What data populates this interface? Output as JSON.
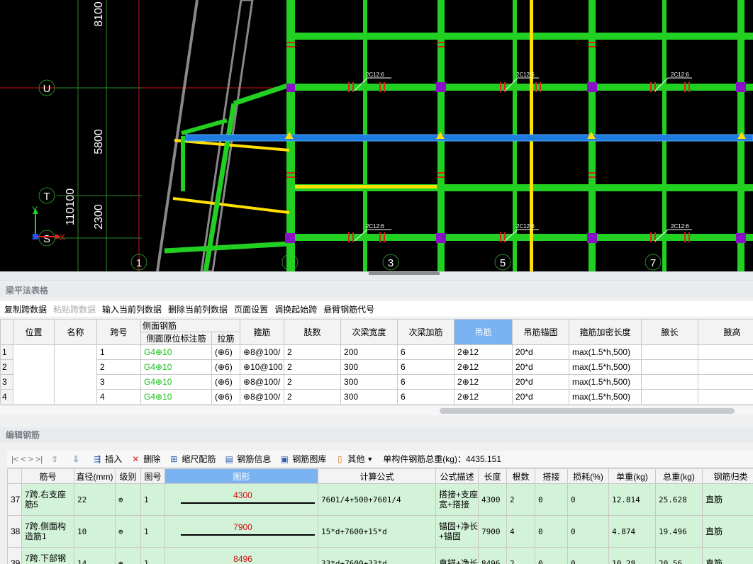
{
  "cad": {
    "dim_labels": [
      "8100",
      "5800",
      "2300",
      "110100"
    ],
    "row_axes": [
      "U",
      "T",
      "S"
    ],
    "col_axes": [
      "1",
      "2",
      "3",
      "5",
      "7"
    ],
    "beam_labels": [
      "2C12:6",
      "2C12:6",
      "2C12:6",
      "2C12:6",
      "2C12:6",
      "2C12:6"
    ],
    "axis_x": "X",
    "axis_y": "Y"
  },
  "beam_table": {
    "title": "梁平法表格",
    "toolbar": [
      "复制跨数据",
      "粘贴跨数据",
      "输入当前列数据",
      "删除当前列数据",
      "页面设置",
      "调换起始跨",
      "悬臂钢筋代号"
    ],
    "group_header": "侧面钢筋",
    "headers": [
      "位置",
      "名称",
      "跨号",
      "侧面原位标注筋",
      "拉筋",
      "箍筋",
      "肢数",
      "次梁宽度",
      "次梁加筋",
      "吊筋",
      "吊筋锚固",
      "箍筋加密长度",
      "腋长",
      "腋高"
    ],
    "rows": [
      [
        "1",
        "",
        "",
        "1",
        "G4⊕10",
        "(⊕6)",
        "⊕8@100/",
        "2",
        "200",
        "6",
        "2⊕12",
        "20*d",
        "max(1.5*h,500)",
        "",
        ""
      ],
      [
        "2",
        "",
        "",
        "2",
        "G4⊕10",
        "(⊕6)",
        "⊕10@100",
        "2",
        "300",
        "6",
        "2⊕12",
        "20*d",
        "max(1.5*h,500)",
        "",
        ""
      ],
      [
        "3",
        "",
        "",
        "3",
        "G4⊕10",
        "(⊕6)",
        "⊕8@100/",
        "2",
        "300",
        "6",
        "2⊕12",
        "20*d",
        "max(1.5*h,500)",
        "",
        ""
      ],
      [
        "4",
        "",
        "",
        "4",
        "G4⊕10",
        "(⊕6)",
        "⊕8@100/",
        "2",
        "300",
        "6",
        "2⊕12",
        "20*d",
        "max(1.5*h,500)",
        "",
        ""
      ]
    ]
  },
  "edit_rebar": {
    "title": "编辑钢筋",
    "nav": "|<  <  >  >|",
    "tools": [
      "插入",
      "删除",
      "缩尺配筋",
      "钢筋信息",
      "钢筋图库",
      "其他"
    ],
    "total_label": "单构件钢筋总重(kg)：4435.151",
    "headers": [
      "筋号",
      "直径(mm)",
      "级别",
      "图号",
      "图形",
      "计算公式",
      "公式描述",
      "长度",
      "根数",
      "搭接",
      "损耗(%)",
      "单重(kg)",
      "总重(kg)",
      "钢筋归类"
    ],
    "rows": [
      {
        "no": "37",
        "name": "7跨.右支座筋5",
        "dia": "22",
        "grade": "⊕",
        "fig": "1",
        "shape": "4300",
        "formula": "7601/4+500+7601/4",
        "desc": "搭接+支座宽+搭接",
        "len": "4300",
        "count": "2",
        "lap": "0",
        "loss": "0",
        "unit": "12.814",
        "total": "25.628",
        "cat": "直筋"
      },
      {
        "no": "38",
        "name": "7跨.侧面构造筋1",
        "dia": "10",
        "grade": "⊕",
        "fig": "1",
        "shape": "7900",
        "formula": "15*d+7600+15*d",
        "desc": "锚固+净长+锚固",
        "len": "7900",
        "count": "4",
        "lap": "0",
        "loss": "0",
        "unit": "4.874",
        "total": "19.496",
        "cat": "直筋"
      },
      {
        "no": "39",
        "name": "7跨.下部钢筋",
        "dia": "14",
        "grade": "⊕",
        "fig": "1",
        "shape": "8496",
        "formula": "33*d+7600+33*d",
        "desc": "直锚+净长",
        "len": "8496",
        "count": "2",
        "lap": "0",
        "loss": "0",
        "unit": "10.28",
        "total": "20.56",
        "cat": "直筋"
      }
    ]
  },
  "colors": {
    "accent": "#7ab2f2",
    "row_green": "#d3f3d8",
    "beam_green": "#22d022",
    "beam_blue": "#1e7be0",
    "rebar_text": "#19c219"
  }
}
